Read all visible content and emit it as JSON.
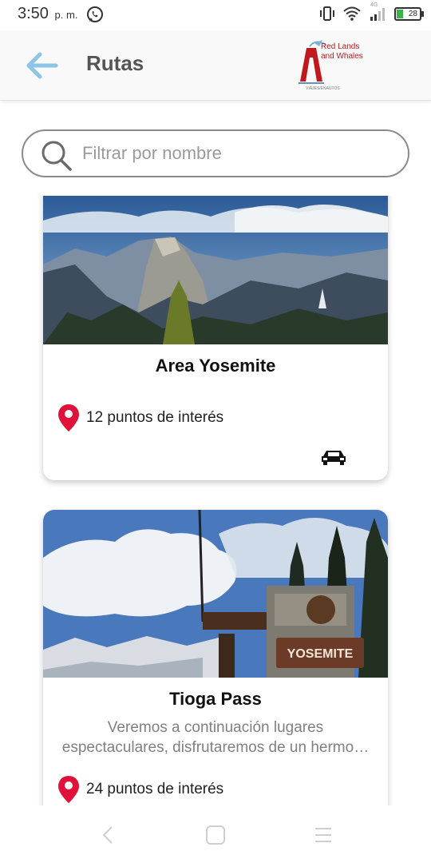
{
  "status_bar": {
    "time": "3:50",
    "time_suffix": "p. m.",
    "battery": "28",
    "network": "4G"
  },
  "header": {
    "title": "Rutas",
    "logo_text": "Red Lands and Whales",
    "logo_subtext": "VIAJES/ENAUTOS"
  },
  "search": {
    "placeholder": "Filtrar por nombre",
    "value": ""
  },
  "routes": [
    {
      "title": "Area Yosemite",
      "description": "",
      "poi": "12 puntos de interés",
      "transport": "car-icon"
    },
    {
      "title": "Tioga Pass",
      "description": "Veremos a continuación lugares espectaculares, disfrutaremos de un hermo…",
      "poi": "24 puntos de interés",
      "sign_text": "YOSEMITE"
    }
  ],
  "colors": {
    "accent": "#8ec5e6",
    "pin": "#e0123a",
    "title_gray": "#555555"
  }
}
